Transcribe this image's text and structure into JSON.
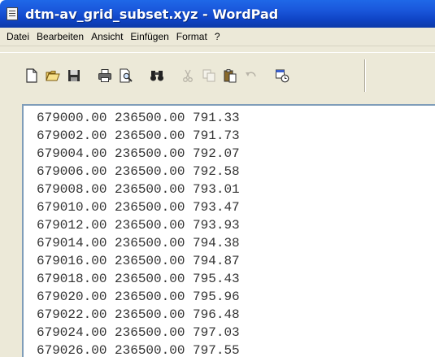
{
  "window": {
    "title": "dtm-av_grid_subset.xyz - WordPad"
  },
  "menubar": {
    "items": [
      "Datei",
      "Bearbeiten",
      "Ansicht",
      "Einfügen",
      "Format",
      "?"
    ]
  },
  "toolbar": {
    "buttons": [
      {
        "icon": "new-document-icon"
      },
      {
        "icon": "open-folder-icon"
      },
      {
        "icon": "save-disk-icon"
      },
      {
        "icon": "print-icon"
      },
      {
        "icon": "print-preview-icon"
      },
      {
        "icon": "find-binoculars-icon"
      },
      {
        "icon": "cut-scissors-icon"
      },
      {
        "icon": "copy-icon"
      },
      {
        "icon": "paste-icon"
      },
      {
        "icon": "undo-icon"
      },
      {
        "icon": "date-time-icon"
      }
    ]
  },
  "document": {
    "lines": [
      "679000.00 236500.00 791.33",
      "679002.00 236500.00 791.73",
      "679004.00 236500.00 792.07",
      "679006.00 236500.00 792.58",
      "679008.00 236500.00 793.01",
      "679010.00 236500.00 793.47",
      "679012.00 236500.00 793.93",
      "679014.00 236500.00 794.38",
      "679016.00 236500.00 794.87",
      "679018.00 236500.00 795.43",
      "679020.00 236500.00 795.96",
      "679022.00 236500.00 796.48",
      "679024.00 236500.00 797.03",
      "679026.00 236500.00 797.55"
    ]
  },
  "colors": {
    "titlebar": "#0c3aa8",
    "chrome": "#ece9d8",
    "text": "#333333"
  }
}
